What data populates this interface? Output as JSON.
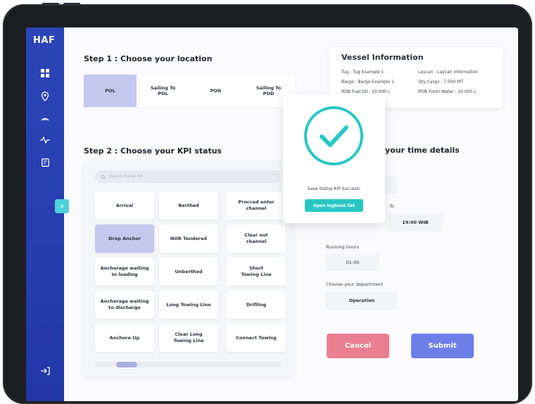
{
  "logo": "HAF",
  "step1": {
    "title": "Step 1 : Choose your location",
    "options": [
      {
        "label": "POL",
        "active": true
      },
      {
        "label": "Sailing To\nPOL",
        "active": false
      },
      {
        "label": "POD",
        "active": false
      },
      {
        "label": "Sailing To\nPOD",
        "active": false
      }
    ]
  },
  "vessel": {
    "title": "Vessel Information",
    "tug": "Tug : Tug Example 1",
    "barge": "Barge : Barge Example 1",
    "rob_fuel": "ROB Fuel Oil : 10.000 L",
    "laycan": "Laycan : Laycan Information",
    "qty_cargo": "Qty Cargo : 7.500 MT",
    "rob_water": "ROB Fresh Water : 10.000 L"
  },
  "step2": {
    "title": "Step 2 : Choose your KPI status",
    "search_placeholder": "Search Status KPI...",
    "kpi_items": [
      {
        "label": "Arrival",
        "active": false
      },
      {
        "label": "Berthed",
        "active": false
      },
      {
        "label": "Procced enter\nchannel",
        "active": false
      },
      {
        "label": "Drop Anchor",
        "active": true
      },
      {
        "label": "NOR Tendered",
        "active": false
      },
      {
        "label": "Clear out\nchannel",
        "active": false
      },
      {
        "label": "Anchorage waiting\nto loading",
        "active": false
      },
      {
        "label": "Unberthed",
        "active": false
      },
      {
        "label": "Short\nTowing Line",
        "active": false
      },
      {
        "label": "Anchorage waiting\nto discharge",
        "active": false
      },
      {
        "label": "Long Towing Line",
        "active": false
      },
      {
        "label": "Drifting",
        "active": false
      },
      {
        "label": "Anchore Up",
        "active": false
      },
      {
        "label": "Clear Long\nTowing Line",
        "active": false
      },
      {
        "label": "Connect Towing",
        "active": false
      }
    ]
  },
  "step3": {
    "title_visible": "your time details",
    "to_label": "To",
    "to_time": "19:00 WIB",
    "running_hours_label": "Running hours",
    "running_hours_value": "01:00",
    "department_label": "Choose your department",
    "department_value": "Operation"
  },
  "modal": {
    "message": "Save Status KPI Success!",
    "button": "Open logbook list"
  },
  "actions": {
    "cancel": "Cancel",
    "submit": "Submit"
  },
  "colors": {
    "sidebar": "#2b45b8",
    "active_option": "#c3c8ef",
    "success": "#28c7c4",
    "cancel": "#ea7f91",
    "submit": "#6c7fe9"
  }
}
